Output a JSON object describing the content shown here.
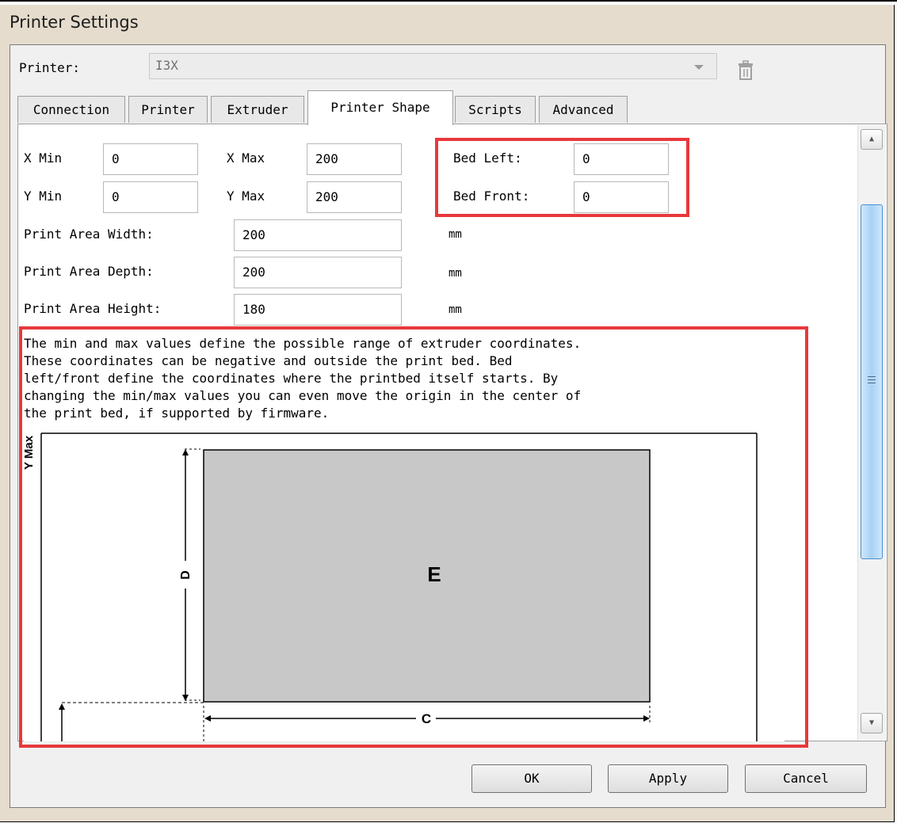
{
  "window": {
    "title": "Printer Settings"
  },
  "printer": {
    "label": "Printer:",
    "value": "I3X"
  },
  "tabs": [
    {
      "label": "Connection"
    },
    {
      "label": "Printer"
    },
    {
      "label": "Extruder"
    },
    {
      "label": "Printer Shape"
    },
    {
      "label": "Scripts"
    },
    {
      "label": "Advanced"
    }
  ],
  "shape": {
    "x_min": {
      "label": "X Min",
      "value": "0"
    },
    "x_max": {
      "label": "X Max",
      "value": "200"
    },
    "y_min": {
      "label": "Y Min",
      "value": "0"
    },
    "y_max": {
      "label": "Y Max",
      "value": "200"
    },
    "bed_left": {
      "label": "Bed Left:",
      "value": "0"
    },
    "bed_front": {
      "label": "Bed Front:",
      "value": "0"
    },
    "width": {
      "label": "Print Area Width:",
      "value": "200",
      "unit": "mm"
    },
    "depth": {
      "label": "Print Area Depth:",
      "value": "200",
      "unit": "mm"
    },
    "height": {
      "label": "Print Area Height:",
      "value": "180",
      "unit": "mm"
    }
  },
  "description": "The min and max values define the possible range of extruder coordinates.\nThese coordinates can be negative and outside the print bed. Bed\nleft/front define the coordinates where the printbed itself starts. By\nchanging the min/max values you can even move the origin in the center of\nthe print bed, if supported by firmware.",
  "diagram": {
    "y_max_label": "Y Max",
    "bed_label": "E",
    "depth_label": "D",
    "width_label": "C"
  },
  "buttons": {
    "ok": "OK",
    "apply": "Apply",
    "cancel": "Cancel"
  },
  "colors": {
    "highlight": "#e8383c",
    "bed_fill": "#c8c8c8",
    "dialog_bg": "#e5dccd"
  }
}
